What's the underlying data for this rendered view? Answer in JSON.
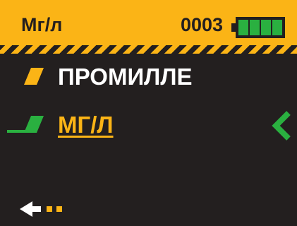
{
  "header": {
    "title": "Мг/л",
    "counter": "0003",
    "battery_level": 1.0,
    "battery_cells": 4
  },
  "menu": {
    "items": [
      {
        "label": "ПРОМИЛЛЕ",
        "selected": false
      },
      {
        "label": "МГ/Л",
        "selected": true
      }
    ]
  },
  "colors": {
    "accent": "#fbb416",
    "background": "#231f1f",
    "selected_marker": "#2ab040",
    "battery_fill": "#2ab040",
    "text": "#ffffff"
  },
  "icons": {
    "unselected_marker": "slanted-parallelogram-icon",
    "selected_marker": "slanted-parallelogram-icon",
    "selection_indicator": "chevron-left-icon",
    "back": "back-arrow-icon",
    "battery": "battery-icon"
  }
}
